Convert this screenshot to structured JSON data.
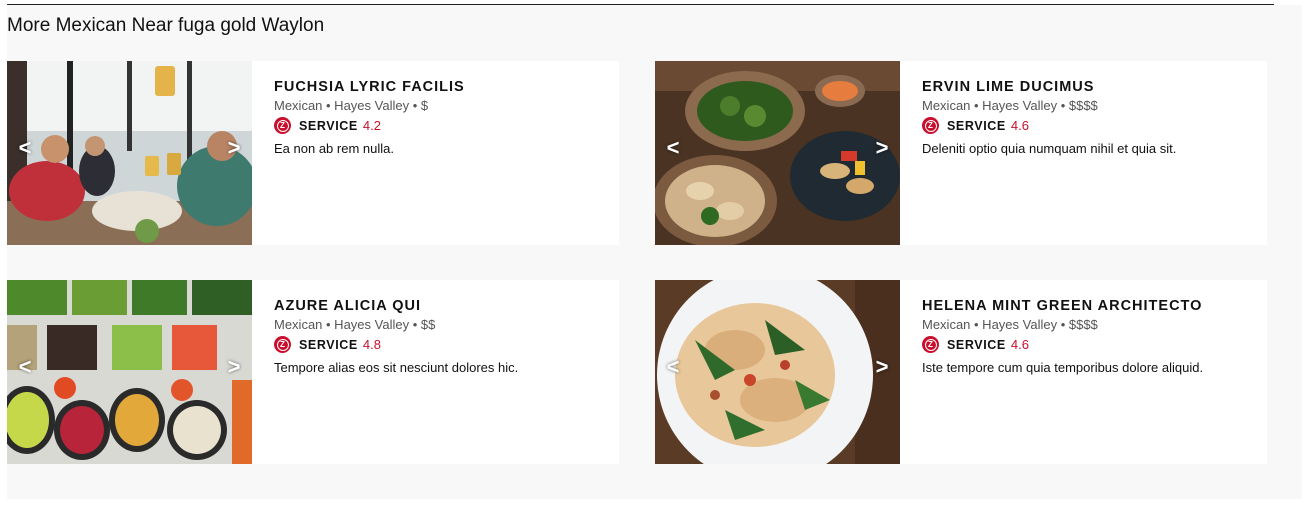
{
  "section": {
    "title": "More Mexican Near fuga gold Waylon"
  },
  "carousel": {
    "prev": "<",
    "next": ">"
  },
  "badge": {
    "icon": "zagat-z-icon",
    "letter": "Z",
    "color": "#c8102e"
  },
  "restaurants": [
    {
      "name": "FUCHSIA LYRIC FACILIS",
      "meta": "Mexican • Hayes Valley • $",
      "service_label": "SERVICE",
      "service_score": "4.2",
      "description": "Ea non ab rem nulla.",
      "photo": "friends-toasting-beers-photo"
    },
    {
      "name": "ERVIN LIME DUCIMUS",
      "meta": "Mexican • Hayes Valley • $$$$",
      "service_label": "SERVICE",
      "service_score": "4.6",
      "description": "Deleniti optio quia numquam nihil et quia sit.",
      "photo": "dumplings-bowls-photo"
    },
    {
      "name": "AZURE ALICIA QUI",
      "meta": "Mexican • Hayes Valley • $$",
      "service_label": "SERVICE",
      "service_score": "4.8",
      "description": "Tempore alias eos sit nesciunt dolores hic.",
      "photo": "salad-bar-vegetables-photo"
    },
    {
      "name": "HELENA MINT GREEN ARCHITECTO",
      "meta": "Mexican • Hayes Valley • $$$$",
      "service_label": "SERVICE",
      "service_score": "4.6",
      "description": "Iste tempore cum quia temporibus dolore aliquid.",
      "photo": "pasta-plate-photo"
    }
  ]
}
